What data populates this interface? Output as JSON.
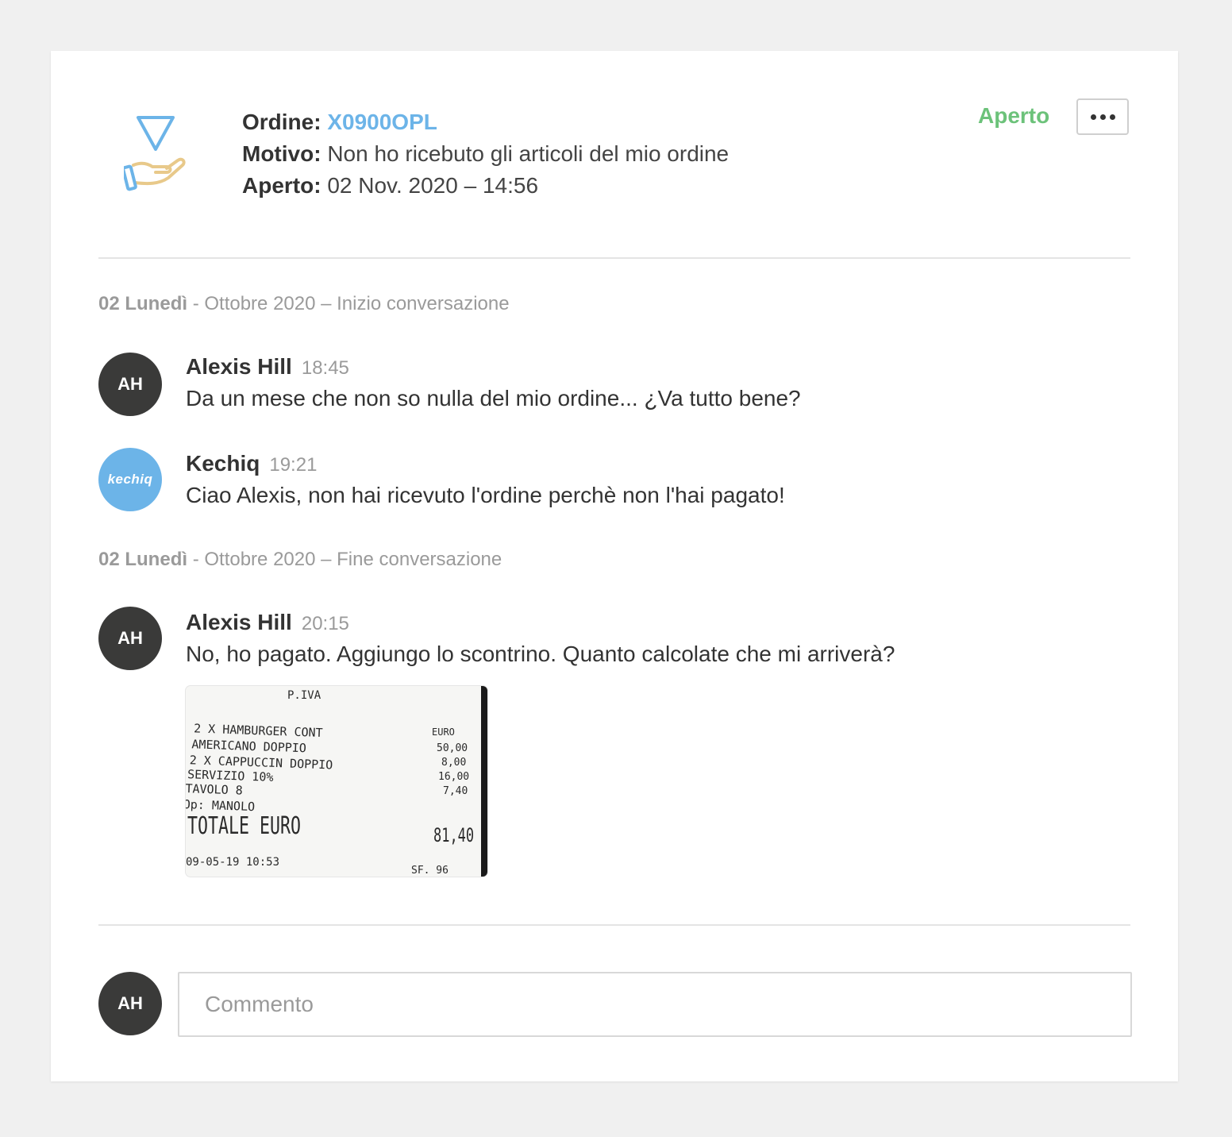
{
  "header": {
    "order_label": "Ordine:",
    "order_id": "X0900OPL",
    "reason_label": "Motivo:",
    "reason_value": "Non ho ricebuto gli articoli del mio ordine",
    "opened_label": "Aperto:",
    "opened_value": "02 Nov. 2020 – 14:56",
    "status": "Aperto",
    "status_color": "#6cc27a",
    "more_icon": "more-horizontal-icon",
    "claim_icon": "hand-triangle-icon"
  },
  "separators": [
    {
      "day": "02 Lunedì",
      "rest": " - Ottobre 2020 – Inizio conversazione"
    },
    {
      "day": "02 Lunedì",
      "rest": " - Ottobre 2020 – Fine conversazione"
    }
  ],
  "messages": [
    {
      "initials": "AH",
      "name": "Alexis Hill",
      "time": "18:45",
      "text": "Da un mese che non so nulla del mio ordine... ¿Va tutto bene?"
    },
    {
      "initials": "kechiq",
      "name": "Kechiq",
      "time": "19:21",
      "text": "Ciao Alexis, non hai ricevuto l'ordine perchè non l'hai pagato!"
    },
    {
      "initials": "AH",
      "name": "Alexis Hill",
      "time": "20:15",
      "text": "No, ho pagato. Aggiungo lo scontrino. Quanto calcolate che mi arriverà?"
    }
  ],
  "receipt": {
    "header": "P.IVA",
    "currency": "EURO",
    "lines": [
      {
        "item": "2 X HAMBURGER CONT",
        "price": ""
      },
      {
        "item": "AMERICANO DOPPIO",
        "price": "50,00"
      },
      {
        "item": "2 X CAPPUCCIN DOPPIO",
        "price": "8,00"
      },
      {
        "item": "SERVIZIO 10%",
        "price": "16,00"
      },
      {
        "item": "TAVOLO 8",
        "price": "7,40"
      },
      {
        "item": "Op: MANOLO",
        "price": ""
      }
    ],
    "total_label": "TOTALE EURO",
    "total_value": "81,40",
    "footer_date": "09-05-19   10:53",
    "footer_code": "SF.   96"
  },
  "composer": {
    "initials": "AH",
    "placeholder": "Commento"
  },
  "colors": {
    "accent": "#6cb4e8",
    "avatar_bg": "#3a3a39"
  }
}
